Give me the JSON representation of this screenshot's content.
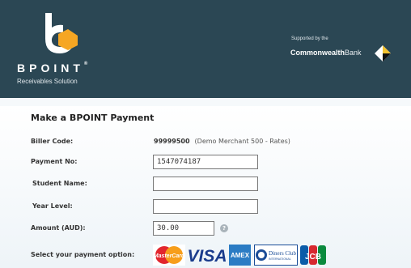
{
  "header": {
    "brand": "BPOINT",
    "trademark": "®",
    "tagline": "Receivables Solution",
    "supported_by": "Supported by the",
    "bank_bold": "Commonwealth",
    "bank_light": "Bank",
    "background": "#2b4754",
    "logo_accent": "#f6a623"
  },
  "form": {
    "title": "Make a BPOINT Payment",
    "biller_code_label": "Biller Code:",
    "biller_code_value": "99999500",
    "biller_name": "(Demo Merchant 500 - Rates)",
    "payment_no_label": "Payment No:",
    "payment_no_value": "1547074187",
    "student_name_label": "Student Name:",
    "student_name_value": "",
    "year_level_label": "Year Level:",
    "year_level_value": "",
    "amount_label": "Amount (AUD):",
    "amount_value": "30.00",
    "payment_option_label": "Select your payment option:"
  },
  "icons": {
    "help": "help-icon",
    "cards": [
      "mastercard-icon",
      "visa-icon",
      "amex-icon",
      "diners-club-icon",
      "jcb-icon"
    ]
  },
  "card_labels": {
    "mastercard": "MasterCard",
    "visa": "VISA",
    "amex": "AMEX",
    "diners_1": "Diners Club",
    "diners_2": "INTERNATIONAL",
    "jcb": "JCB"
  }
}
